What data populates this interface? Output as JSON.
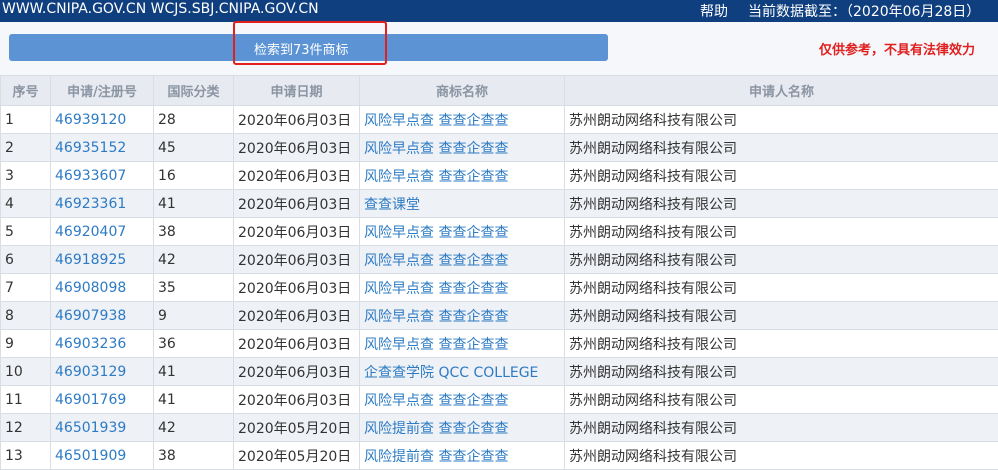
{
  "header": {
    "site_urls": "WWW.CNIPA.GOV.CN WCJS.SBJ.CNIPA.GOV.CN",
    "help_label": "帮助",
    "data_date": "当前数据截至：（2020年06月28日）"
  },
  "result_bar": {
    "text": "检索到73件商标"
  },
  "disclaimer": "仅供参考，不具有法律效力",
  "table": {
    "headers": [
      "序号",
      "申请/注册号",
      "国际分类",
      "申请日期",
      "商标名称",
      "申请人名称"
    ],
    "rows": [
      {
        "seq": "1",
        "reg_no": "46939120",
        "class": "28",
        "date": "2020年06月03日",
        "name": "风险早点查 查查企查查",
        "applicant": "苏州朗动网络科技有限公司"
      },
      {
        "seq": "2",
        "reg_no": "46935152",
        "class": "45",
        "date": "2020年06月03日",
        "name": "风险早点查 查查企查查",
        "applicant": "苏州朗动网络科技有限公司"
      },
      {
        "seq": "3",
        "reg_no": "46933607",
        "class": "16",
        "date": "2020年06月03日",
        "name": "风险早点查 查查企查查",
        "applicant": "苏州朗动网络科技有限公司"
      },
      {
        "seq": "4",
        "reg_no": "46923361",
        "class": "41",
        "date": "2020年06月03日",
        "name": "查查课堂",
        "applicant": "苏州朗动网络科技有限公司"
      },
      {
        "seq": "5",
        "reg_no": "46920407",
        "class": "38",
        "date": "2020年06月03日",
        "name": "风险早点查 查查企查查",
        "applicant": "苏州朗动网络科技有限公司"
      },
      {
        "seq": "6",
        "reg_no": "46918925",
        "class": "42",
        "date": "2020年06月03日",
        "name": "风险早点查 查查企查查",
        "applicant": "苏州朗动网络科技有限公司"
      },
      {
        "seq": "7",
        "reg_no": "46908098",
        "class": "35",
        "date": "2020年06月03日",
        "name": "风险早点查 查查企查查",
        "applicant": "苏州朗动网络科技有限公司"
      },
      {
        "seq": "8",
        "reg_no": "46907938",
        "class": "9",
        "date": "2020年06月03日",
        "name": "风险早点查 查查企查查",
        "applicant": "苏州朗动网络科技有限公司"
      },
      {
        "seq": "9",
        "reg_no": "46903236",
        "class": "36",
        "date": "2020年06月03日",
        "name": "风险早点查 查查企查查",
        "applicant": "苏州朗动网络科技有限公司"
      },
      {
        "seq": "10",
        "reg_no": "46903129",
        "class": "41",
        "date": "2020年06月03日",
        "name": "企查查学院 QCC COLLEGE",
        "applicant": "苏州朗动网络科技有限公司"
      },
      {
        "seq": "11",
        "reg_no": "46901769",
        "class": "41",
        "date": "2020年06月03日",
        "name": "风险早点查 查查企查查",
        "applicant": "苏州朗动网络科技有限公司"
      },
      {
        "seq": "12",
        "reg_no": "46501939",
        "class": "42",
        "date": "2020年05月20日",
        "name": "风险提前查 查查企查查",
        "applicant": "苏州朗动网络科技有限公司"
      },
      {
        "seq": "13",
        "reg_no": "46501909",
        "class": "38",
        "date": "2020年05月20日",
        "name": "风险提前查 查查企查查",
        "applicant": "苏州朗动网络科技有限公司"
      }
    ]
  }
}
